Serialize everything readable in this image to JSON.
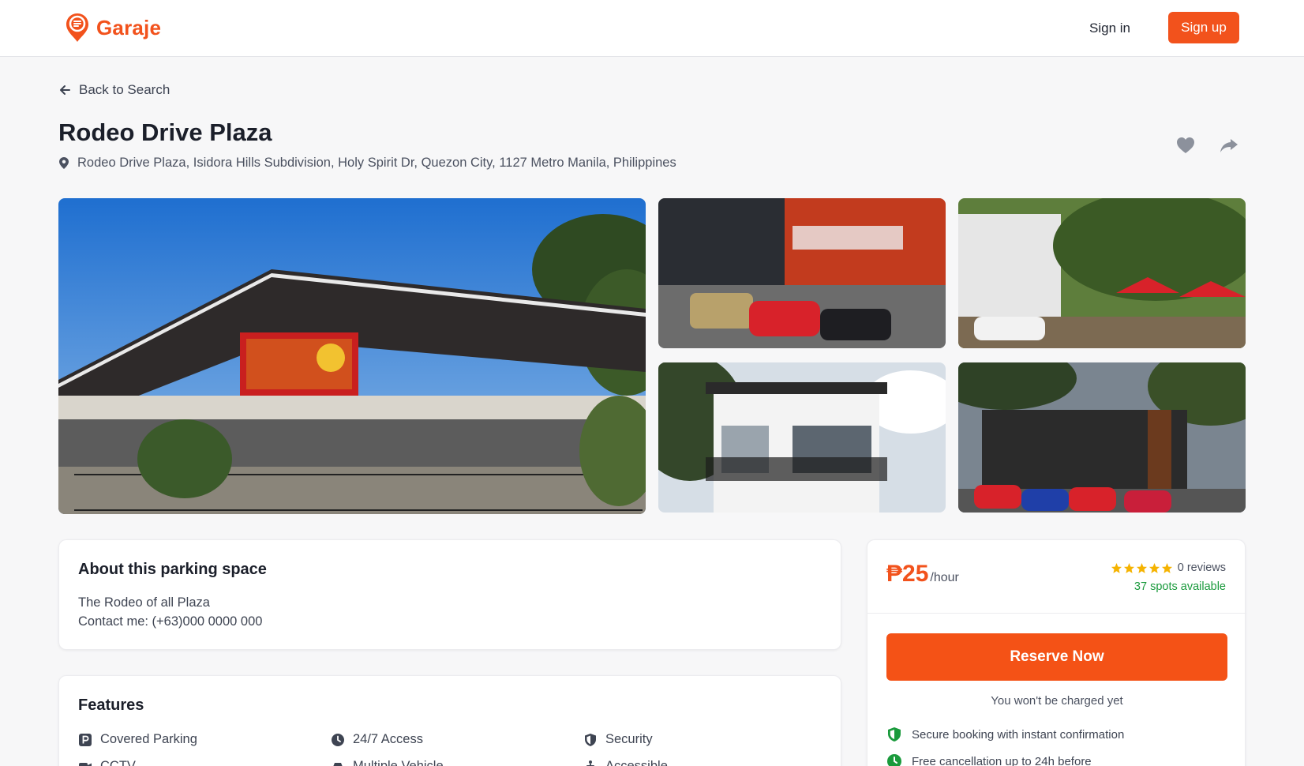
{
  "header": {
    "brand": "Garaje",
    "sign_in": "Sign in",
    "sign_up": "Sign up"
  },
  "nav": {
    "back": "Back to Search"
  },
  "listing": {
    "title": "Rodeo Drive Plaza",
    "address": "Rodeo Drive Plaza, Isidora Hills Subdivision, Holy Spirit Dr, Quezon City, 1127 Metro Manila, Philippines"
  },
  "about": {
    "heading": "About this parking space",
    "line1": "The Rodeo of all Plaza",
    "line2": "Contact me: (+63)000 0000 000"
  },
  "features": {
    "heading": "Features",
    "items": [
      {
        "label": "Covered Parking",
        "icon": "parking-icon"
      },
      {
        "label": "24/7 Access",
        "icon": "clock-icon"
      },
      {
        "label": "Security",
        "icon": "shield-icon"
      },
      {
        "label": "CCTV",
        "icon": "camera-icon"
      },
      {
        "label": "Multiple Vehicle",
        "icon": "car-icon"
      },
      {
        "label": "Accessible",
        "icon": "accessibility-icon"
      }
    ]
  },
  "booking": {
    "price": "₱25",
    "unit": "/hour",
    "rating": 5,
    "reviews": "0 reviews",
    "spots": "37 spots available",
    "reserve": "Reserve Now",
    "no_charge": "You won't be charged yet",
    "perks": [
      {
        "label": "Secure booking with instant confirmation",
        "icon": "shield-check-icon"
      },
      {
        "label": "Free cancellation up to 24h before",
        "icon": "clock-icon"
      }
    ]
  },
  "colors": {
    "brand": "#f2521c",
    "success": "#1a9a3c",
    "star": "#f5b301"
  }
}
